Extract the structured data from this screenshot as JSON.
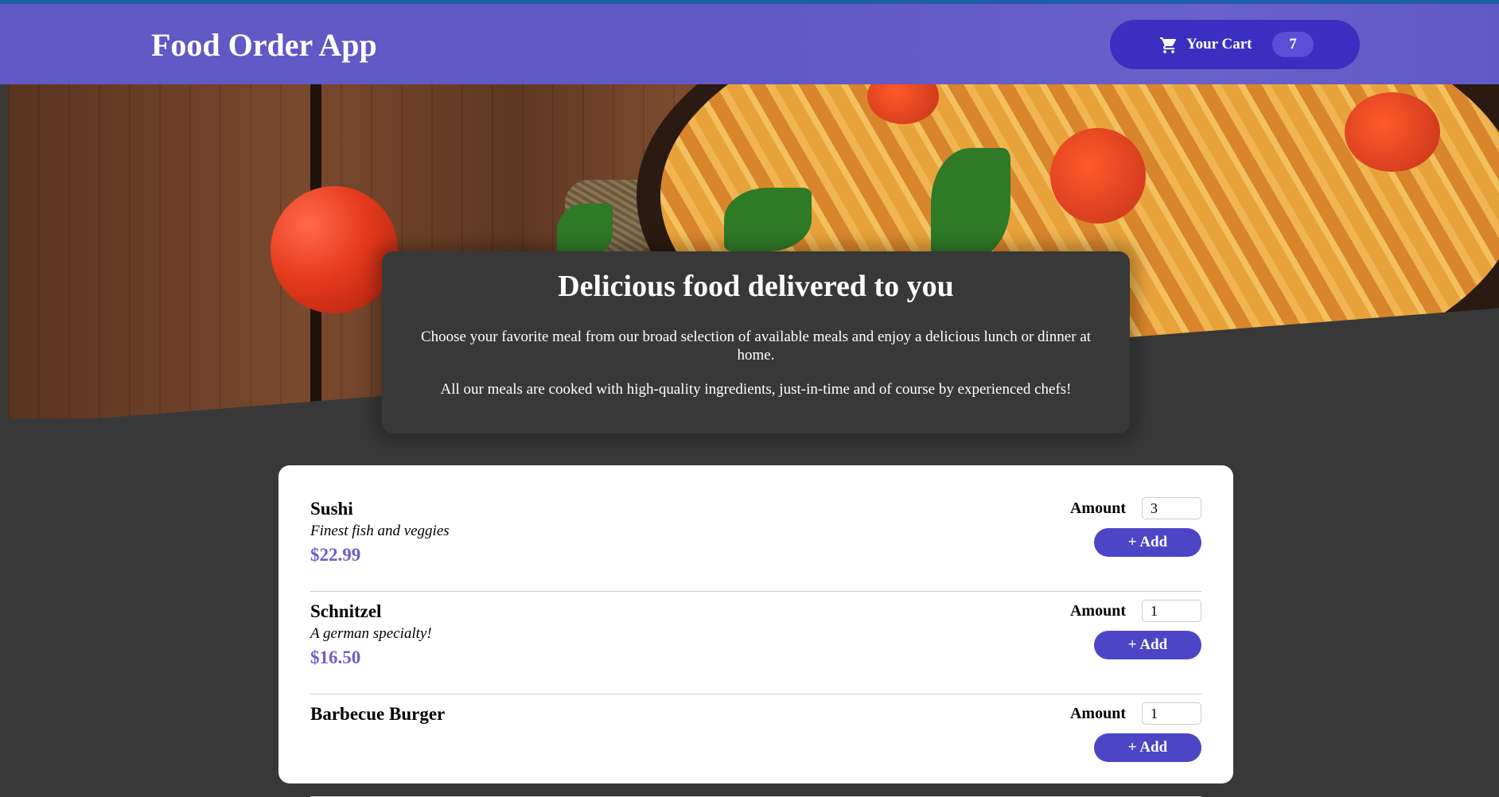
{
  "header": {
    "title": "Food Order App",
    "cart_label": "Your Cart",
    "cart_count": "7",
    "cart_icon": "cart-icon"
  },
  "summary": {
    "heading": "Delicious food delivered to you",
    "paragraph1": "Choose your favorite meal from our broad selection of available meals and enjoy a delicious lunch or dinner at home.",
    "paragraph2": "All our meals are cooked with high-quality ingredients, just-in-time and of course by experienced chefs!"
  },
  "meals": [
    {
      "name": "Sushi",
      "description": "Finest fish and veggies",
      "price": "$22.99",
      "amount_label": "Amount",
      "amount": "3",
      "add_label": "+ Add"
    },
    {
      "name": "Schnitzel",
      "description": "A german specialty!",
      "price": "$16.50",
      "amount_label": "Amount",
      "amount": "1",
      "add_label": "+ Add"
    },
    {
      "name": "Barbecue Burger",
      "description": "",
      "price": "",
      "amount_label": "Amount",
      "amount": "1",
      "add_label": "+ Add"
    }
  ],
  "colors": {
    "header_bg": "#6159c6",
    "cart_button_bg": "#3a2fc0",
    "price_color": "#6a5fcb",
    "add_button_bg": "#4c45c6",
    "page_bg": "#383838"
  }
}
